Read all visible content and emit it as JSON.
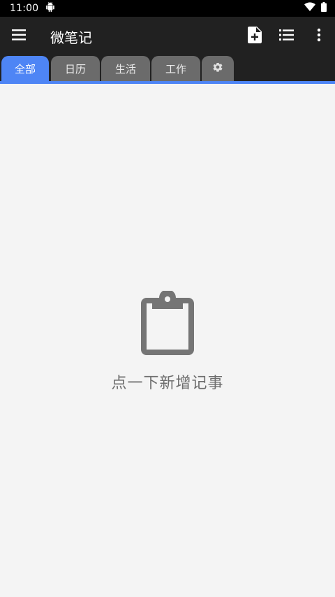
{
  "status_bar": {
    "time": "11:00"
  },
  "app_bar": {
    "title": "微笔记"
  },
  "tabs": [
    {
      "label": "全部",
      "active": true
    },
    {
      "label": "日历",
      "active": false
    },
    {
      "label": "生活",
      "active": false
    },
    {
      "label": "工作",
      "active": false
    }
  ],
  "empty_state": {
    "message": "点一下新增记事"
  },
  "colors": {
    "accent": "#4e85f5",
    "app_bar": "#212121",
    "tab_inactive": "#6b6b6b",
    "background": "#f4f4f4"
  }
}
